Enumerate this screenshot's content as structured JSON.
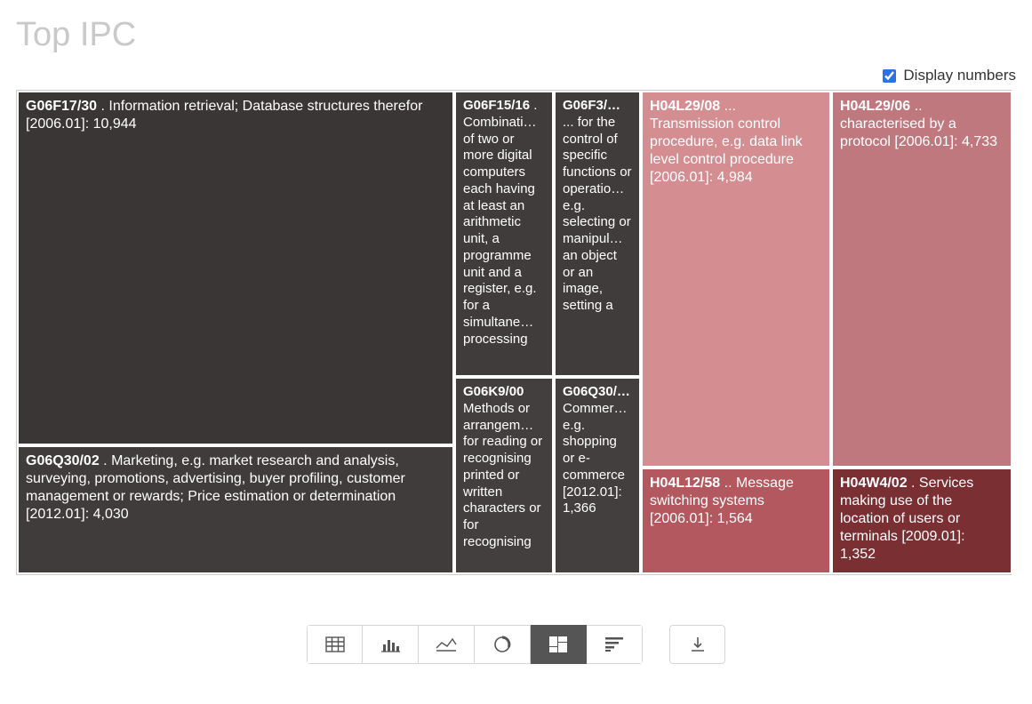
{
  "title": "Top IPC",
  "controls": {
    "display_numbers_label": "Display numbers",
    "display_numbers_checked": true
  },
  "chart_data": {
    "type": "treemap",
    "nodes": [
      {
        "id": "g06f17_30",
        "code": "G06F17/30",
        "label": " . Information retrieval; Database structures therefor [2006.01]: 10,944",
        "value": 10944,
        "color": "#393635"
      },
      {
        "id": "g06q30_02",
        "code": "G06Q30/02",
        "label": " . Marketing, e.g. market research and analysis, surveying, promotions, advertising, buyer profiling, customer management or rewards; Price estimation or determination [2012.01]: 4,030",
        "value": 4030,
        "color": "#3f3c3b"
      },
      {
        "id": "g06f15_16",
        "code": "G06F15/16",
        "label": " . Combinati… of two or more digital computers each having at least an arithmetic unit, a programme unit and a register, e.g. for a simultane… processing",
        "value": 2100,
        "color": "#3f3c3b"
      },
      {
        "id": "g06f3",
        "code": "G06F3/…",
        "label": " ... for the control of specific functions or operatio… e.g. selecting or manipul… an object or an image, setting a",
        "value": 1600,
        "color": "#3f3c3b"
      },
      {
        "id": "g06k9_00",
        "code": "G06K9/00",
        "label": " Methods or arrangem… for reading or recognising printed or written characters or for recognising",
        "value": 1400,
        "color": "#423f3e"
      },
      {
        "id": "g06q30",
        "code": "G06Q30/…",
        "label": " Commer… e.g. shopping or e-commerce [2012.01]: 1,366",
        "value": 1366,
        "color": "#423f3e"
      },
      {
        "id": "h04l29_08",
        "code": "H04L29/08",
        "label": " ... Transmission control procedure, e.g. data link level control procedure [2006.01]: 4,984",
        "value": 4984,
        "color": "#d48d91"
      },
      {
        "id": "h04l29_06",
        "code": "H04L29/06",
        "label": " .. characterised by a protocol [2006.01]: 4,733",
        "value": 4733,
        "color": "#c0787f"
      },
      {
        "id": "h04l12_58",
        "code": "H04L12/58",
        "label": " .. Message switching systems [2006.01]: 1,564",
        "value": 1564,
        "color": "#b2585e"
      },
      {
        "id": "h04w4_02",
        "code": "H04W4/02",
        "label": " . Services making use of the location of users or terminals [2009.01]: 1,352",
        "value": 1352,
        "color": "#7a2f33"
      }
    ]
  },
  "toolbar": {
    "table": "Table",
    "bar": "Bar chart",
    "line": "Line chart",
    "donut": "Donut chart",
    "treemap": "Treemap",
    "list": "List",
    "download": "Download"
  }
}
